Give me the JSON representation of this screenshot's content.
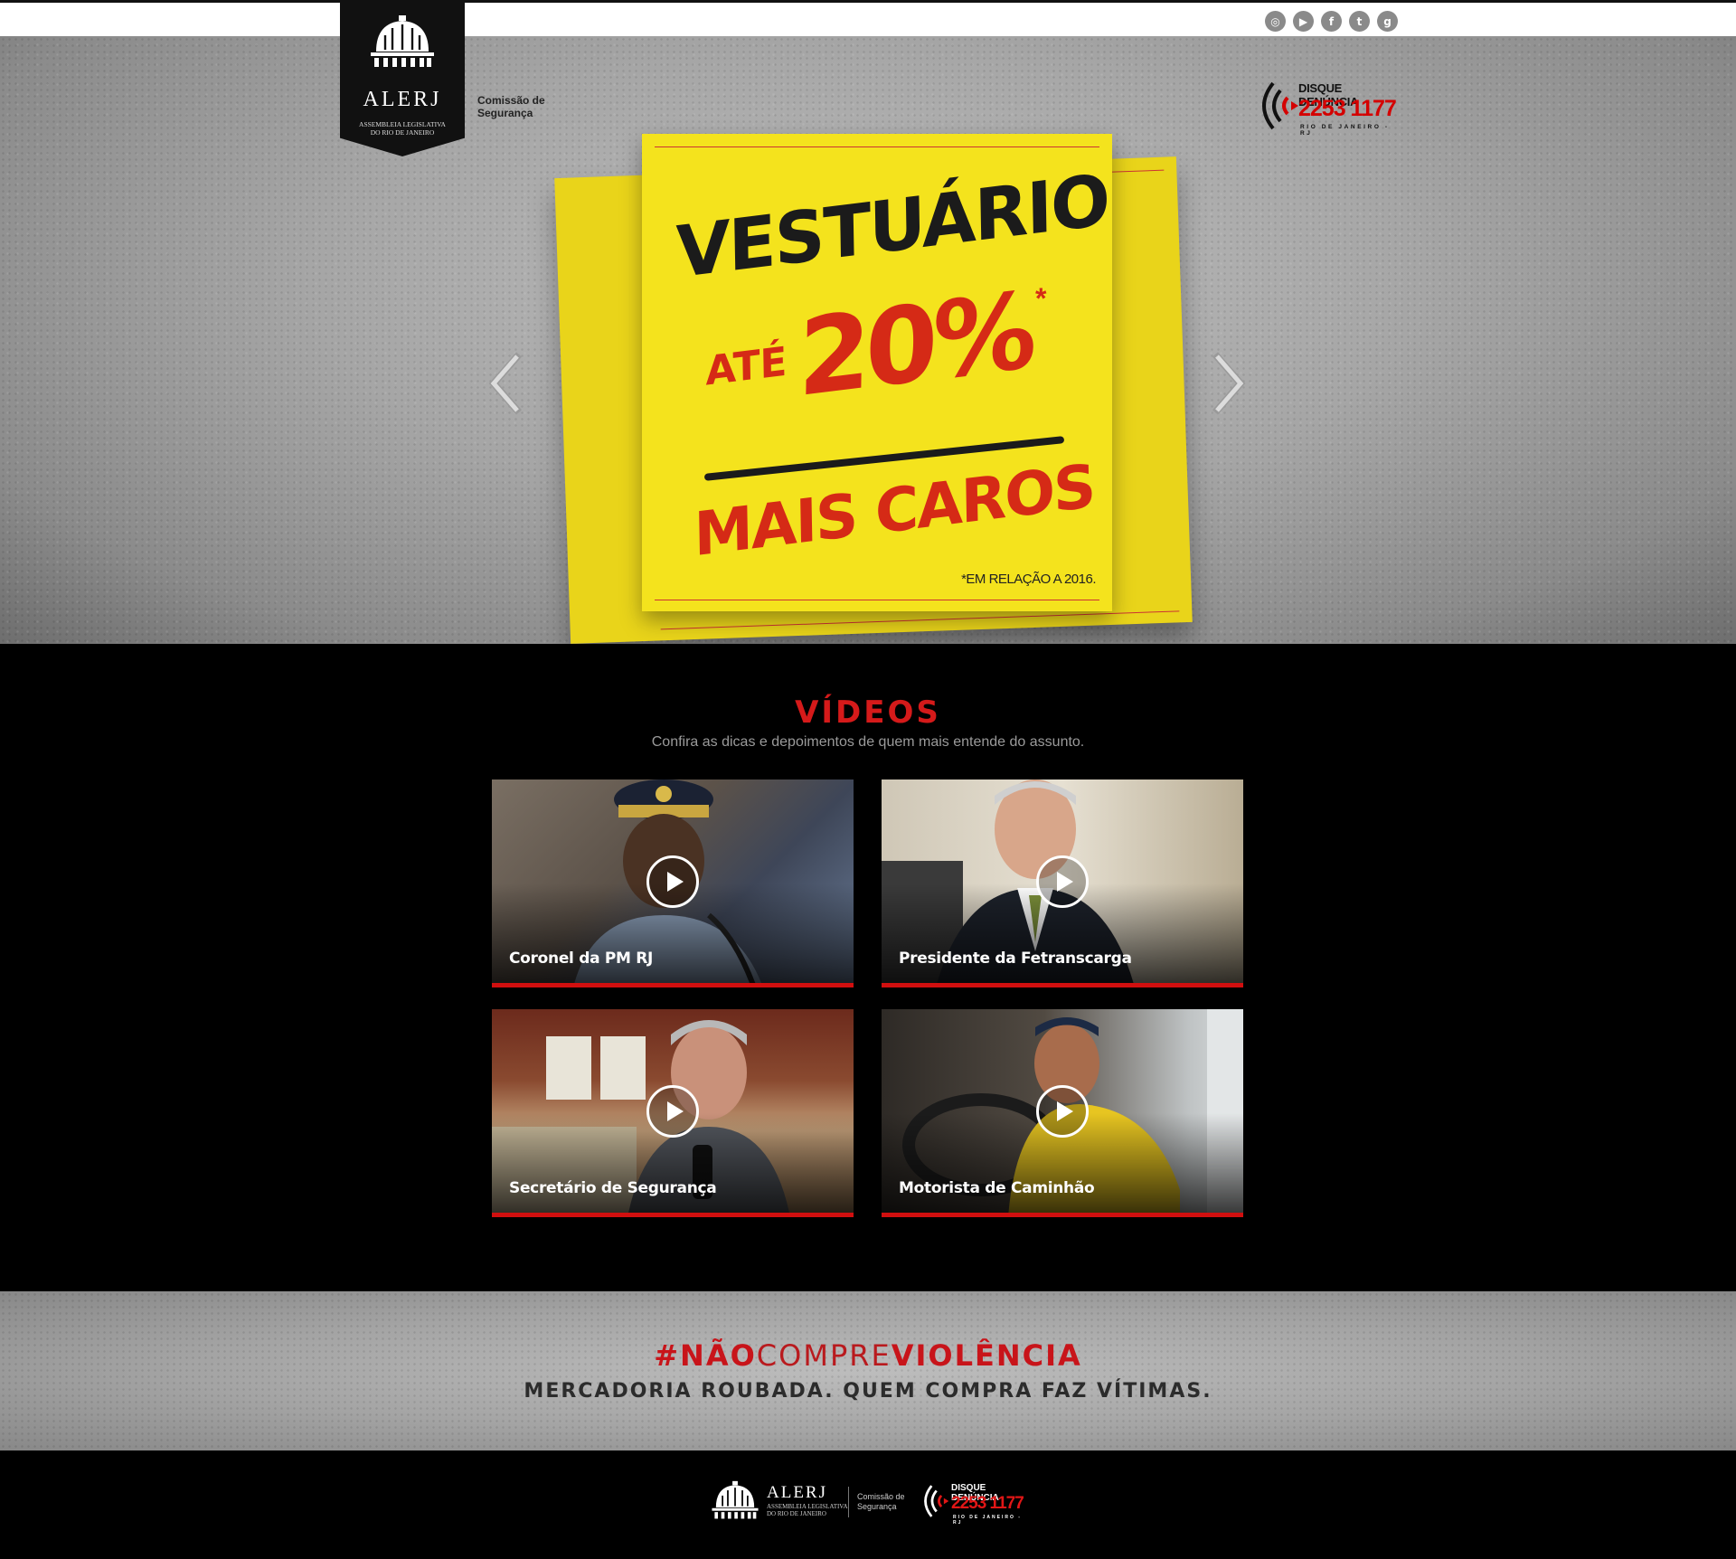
{
  "header": {
    "logo": {
      "name": "ALERJ",
      "subtitle_line1": "ASSEMBLEIA LEGISLATIVA",
      "subtitle_line2": "DO RIO DE JANEIRO"
    },
    "commission_line1": "Comissão de",
    "commission_line2": "Segurança",
    "social_icons": [
      "instagram-icon",
      "youtube-icon",
      "facebook-icon",
      "twitter-icon",
      "google-plus-icon"
    ],
    "disque": {
      "title": "DISQUE DENÚNCIA",
      "phone": "2253 1177",
      "city": "RIO DE JANEIRO - RJ"
    }
  },
  "hero": {
    "headline": "VESTUÁRIO",
    "prefix": "ATÉ",
    "percent": "20%",
    "asterisk": "*",
    "suffix": "MAIS CAROS",
    "footnote": "*EM RELAÇÃO A 2016.",
    "accent_color": "#d52a16",
    "note_color": "#f4e31d"
  },
  "videos": {
    "title": "VÍDEOS",
    "subtitle": "Confira as dicas e depoimentos de quem mais entende do assunto.",
    "items": [
      {
        "label": "Coronel da PM RJ"
      },
      {
        "label": "Presidente da Fetranscarga"
      },
      {
        "label": "Secretário de Segurança"
      },
      {
        "label": "Motorista de Caminhão"
      }
    ]
  },
  "slogan": {
    "hash": "#",
    "word1": "NÃO",
    "word2": "COMPRE",
    "word3": "VIOLÊNCIA",
    "subtitle": "MERCADORIA ROUBADA. QUEM COMPRA FAZ VÍTIMAS."
  },
  "footer": {
    "name": "ALERJ",
    "sub1": "ASSEMBLEIA LEGISLATIVA",
    "sub2": "DO RIO DE JANEIRO",
    "commission_line1": "Comissão de",
    "commission_line2": "Segurança",
    "disque_title": "DISQUE DENÚNCIA",
    "disque_phone": "2253 1177",
    "disque_city": "RIO DE JANEIRO - RJ"
  }
}
